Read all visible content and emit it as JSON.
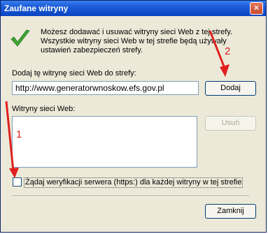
{
  "dialog": {
    "title": "Zaufane witryny",
    "close_symbol": "×",
    "info_line1": "Możesz dodawać i usuwać witryny sieci Web z tej strefy.",
    "info_line2": "Wszystkie witryny sieci Web w tej strefie będą używały",
    "info_line3": "ustawień zabezpieczeń strefy.",
    "add_label": "Dodaj tę witrynę sieci Web do strefy:",
    "url_value": "http://www.generatorwnoskow.efs.gov.pl",
    "add_button": "Dodaj",
    "sites_label": "Witryny sieci Web:",
    "sites": [],
    "remove_button": "Usuń",
    "require_https_label": "Żądaj weryfikacji serwera (https:) dla każdej witryny w tej strefie",
    "require_https_checked": false,
    "close_button": "Zamknij"
  },
  "annotations": {
    "number_1": "1",
    "number_2": "2",
    "color": "#e02020"
  }
}
